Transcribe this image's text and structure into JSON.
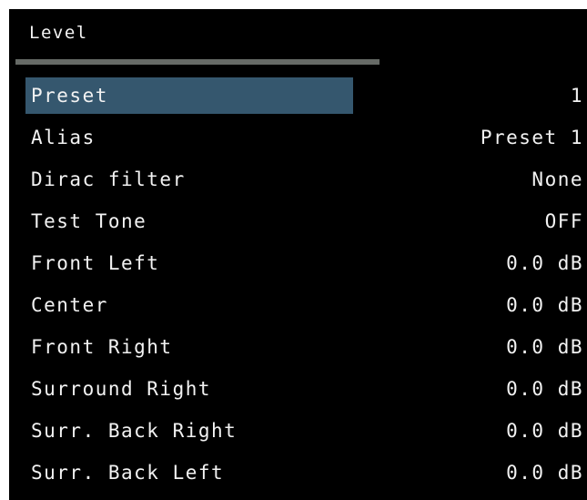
{
  "header": {
    "title": "Level"
  },
  "colors": {
    "background": "#000000",
    "text": "#f2f2f2",
    "selection": "#35576e",
    "divider": "#666a66"
  },
  "menu": {
    "selected_index": 0,
    "items": [
      {
        "label": "Preset",
        "value": "1"
      },
      {
        "label": "Alias",
        "value": "Preset 1"
      },
      {
        "label": "Dirac filter",
        "value": "None"
      },
      {
        "label": "Test Tone",
        "value": "OFF"
      },
      {
        "label": "Front Left",
        "value": "0.0 dB"
      },
      {
        "label": "Center",
        "value": "0.0 dB"
      },
      {
        "label": "Front Right",
        "value": "0.0 dB"
      },
      {
        "label": "Surround Right",
        "value": "0.0 dB"
      },
      {
        "label": "Surr. Back Right",
        "value": "0.0 dB"
      },
      {
        "label": "Surr. Back Left",
        "value": "0.0 dB"
      }
    ]
  }
}
